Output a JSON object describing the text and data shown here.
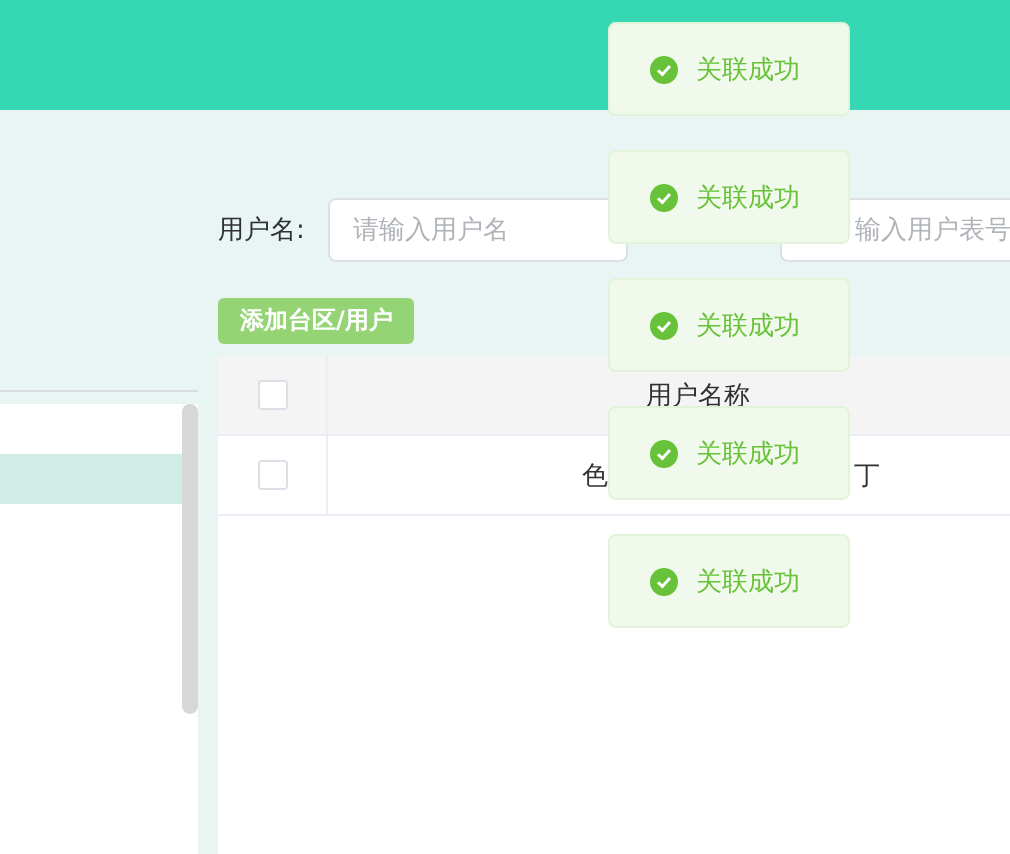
{
  "sidebar": {
    "rows": [
      {
        "selected": false
      },
      {
        "selected": true
      }
    ]
  },
  "filters": [
    {
      "label": "用户名:",
      "placeholder": "请输入用户名"
    },
    {
      "placeholder": "输入用户表号"
    }
  ],
  "buttons": [
    "添加台区/用户"
  ],
  "table": {
    "select_all_checked": false,
    "columns": [
      {
        "kind": "checkbox"
      },
      {
        "kind": "text",
        "title": "用户名称"
      }
    ],
    "rows": [
      {
        "checked": false,
        "name_parts": [
          "色",
          "丁"
        ]
      }
    ]
  },
  "toasts": [
    {
      "message": "关联成功"
    },
    {
      "message": "关联成功"
    },
    {
      "message": "关联成功"
    },
    {
      "message": "关联成功"
    },
    {
      "message": "关联成功"
    }
  ]
}
